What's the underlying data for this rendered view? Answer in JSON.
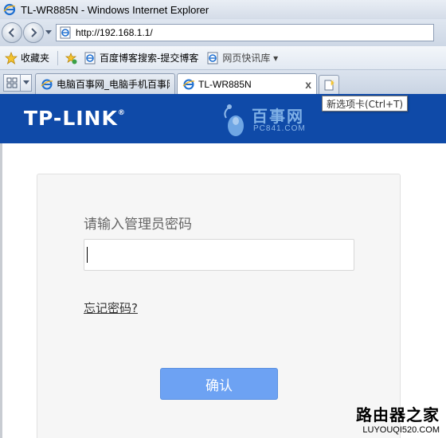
{
  "window": {
    "title": "TL-WR885N - Windows Internet Explorer"
  },
  "address_bar": {
    "url": "http://192.168.1.1/"
  },
  "favorites_bar": {
    "favorites_label": "收藏夹",
    "items": [
      {
        "label": "百度博客搜索-提交博客"
      },
      {
        "label": "网页快讯库 ▾"
      }
    ]
  },
  "tabs": {
    "items": [
      {
        "label": "电脑百事网_电脑手机百事网",
        "active": false
      },
      {
        "label": "TL-WR885N",
        "active": true
      }
    ],
    "close_glyph": "x",
    "new_tab_tooltip": "新选项卡(Ctrl+T)"
  },
  "header": {
    "brand": "TP-LINK",
    "brand_mark": "®",
    "watermark_title": "百事网",
    "watermark_sub": "PC841.COM"
  },
  "login": {
    "password_label": "请输入管理员密码",
    "password_value": "",
    "forgot_link": "忘记密码?",
    "confirm_button": "确认"
  },
  "site_watermark": {
    "cn": "路由器之家",
    "en": "LUYOUQI520.COM"
  },
  "colors": {
    "header_blue": "#0f4aa8",
    "button_blue": "#6da2f3"
  }
}
